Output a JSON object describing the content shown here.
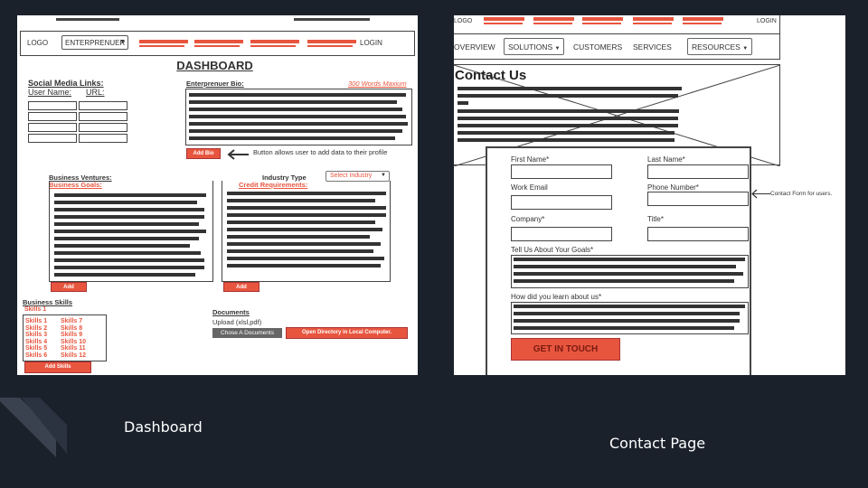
{
  "captions": {
    "dashboard": "Dashboard",
    "contact": "Contact Page"
  },
  "dashboard": {
    "nav": {
      "logo": "LOGO",
      "select": "ENTERPRENUER",
      "login": "LOGIN"
    },
    "title": "DASHBOARD",
    "social": {
      "heading": "Social Media Links:",
      "user_label": "User Name:",
      "url_label": "URL:"
    },
    "bio": {
      "heading": "Enterprenuer Bio:",
      "limit": "300 Words Maxium",
      "button": "Add Bio",
      "note": "Button allows user to add data to their profile"
    },
    "ventures": {
      "heading": "Business Ventures:",
      "goals": "Business Goals:",
      "industry_label": "Industry Type",
      "industry_select": "Select Industry",
      "credit": "Credit Requirements:",
      "add_left": "Add",
      "add_right": "Add"
    },
    "skills": {
      "heading": "Business Skills",
      "first": "Skills 1",
      "col1": [
        "Skills 1",
        "Skills 2",
        "Skills 3",
        "Skills 4",
        "Skills 5",
        "Skills 6"
      ],
      "col2": [
        "Skills 7",
        "Skills 8",
        "Skills 9",
        "Skills 10",
        "Skills 11",
        "Skills 12"
      ],
      "button": "Add Skills"
    },
    "documents": {
      "heading": "Documents",
      "upload": "Upload (xlsl,pdf)",
      "choose": "Chose A Documents",
      "open": "Open Directory in Local Computer."
    }
  },
  "contact": {
    "nav": {
      "logo": "LOGO",
      "login": "LOGIN",
      "overview": "OVERVIEW",
      "solutions": "SOLUTIONS",
      "customers": "CUSTOMERS",
      "services": "SERVICES",
      "resources": "RESOURCES"
    },
    "title": "Contact Us",
    "form": {
      "first_name": "First Name*",
      "last_name": "Last Name*",
      "work_email": "Work Email",
      "phone": "Phone Number*",
      "company": "Company*",
      "job_title": "Title*",
      "goals": "Tell Us About Your Goals*",
      "learn": "How did you learn about us*",
      "submit": "GET IN TOUCH"
    },
    "annotation": "Contact Form for users."
  }
}
